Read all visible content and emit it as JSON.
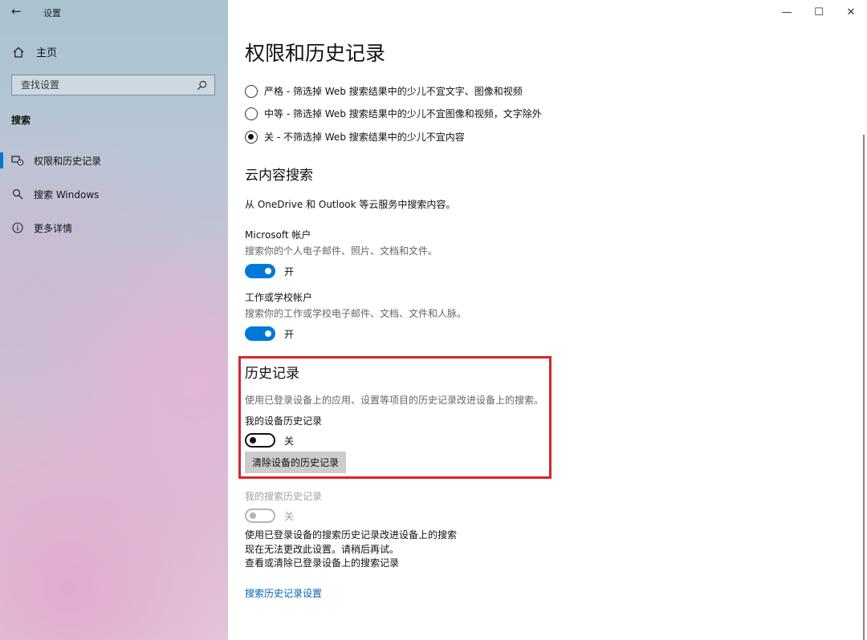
{
  "window": {
    "title": "设置",
    "controls": [
      "minimize-icon",
      "maximize-icon",
      "close-icon"
    ]
  },
  "sidebar": {
    "home_label": "主页",
    "search_placeholder": "查找设置",
    "section": "搜索",
    "items": [
      {
        "label": "权限和历史记录",
        "icon": "permissions-history-icon",
        "active": true
      },
      {
        "label": "搜索 Windows",
        "icon": "search-icon",
        "active": false
      },
      {
        "label": "更多详情",
        "icon": "info-icon",
        "active": false
      }
    ]
  },
  "main": {
    "title": "权限和历史记录",
    "safe_search": {
      "options": [
        {
          "label": "严格 - 筛选掉 Web 搜索结果中的少儿不宜文字、图像和视频",
          "checked": false
        },
        {
          "label": "中等 - 筛选掉 Web 搜索结果中的少儿不宜图像和视频，文字除外",
          "checked": false
        },
        {
          "label": "关 - 不筛选掉 Web 搜索结果中的少儿不宜内容",
          "checked": true
        }
      ]
    },
    "cloud": {
      "heading": "云内容搜索",
      "description": "从 OneDrive 和 Outlook 等云服务中搜索内容。",
      "microsoft_account": {
        "title": "Microsoft 帐户",
        "description": "搜索你的个人电子邮件、照片、文档和文件。",
        "toggle_state": "开"
      },
      "work_account": {
        "title": "工作或学校帐户",
        "description": "搜索你的工作或学校电子邮件、文档、文件和人脉。",
        "toggle_state": "开"
      }
    },
    "history": {
      "heading": "历史记录",
      "description": "使用已登录设备上的应用、设置等项目的历史记录改进设备上的搜索。",
      "device_history_label": "我的设备历史记录",
      "device_history_state": "关",
      "clear_button": "清除设备的历史记录",
      "highlight_color": "#d9252a"
    },
    "search_history": {
      "label": "我的搜索历史记录",
      "state": "关",
      "lines": [
        "使用已登录设备的搜索历史记录改进设备上的搜索",
        "现在无法更改此设置。请稍后再试。",
        "查看或清除已登录设备上的搜索记录"
      ],
      "link": "搜索历史记录设置"
    }
  },
  "colors": {
    "accent": "#0078d7",
    "link": "#0063b1"
  }
}
